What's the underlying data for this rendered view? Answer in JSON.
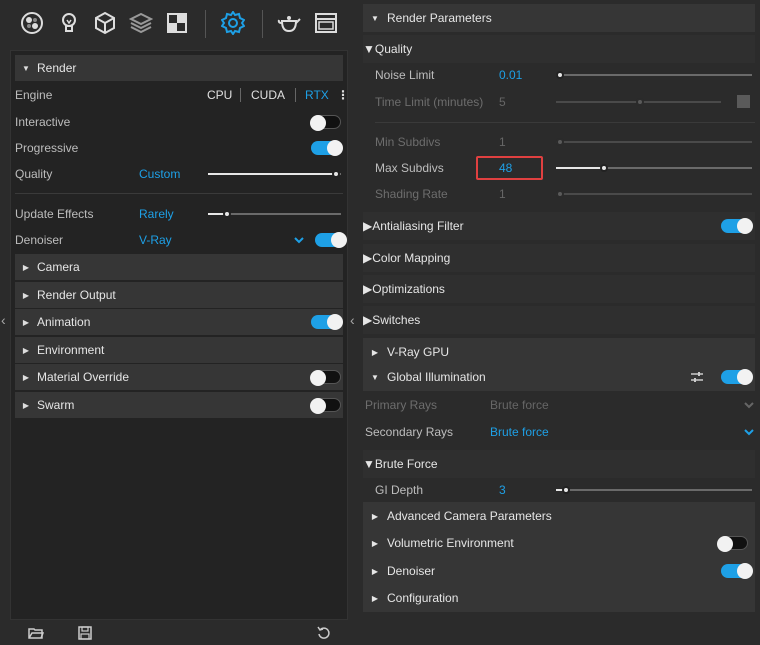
{
  "toolbar": {
    "icons": [
      "material-ball-icon",
      "light-bulb-icon",
      "cube-icon",
      "layers-icon",
      "texture-icon",
      "settings-gear-icon",
      "teapot-render-icon",
      "frame-buffer-icon"
    ]
  },
  "left": {
    "render_section": "Render",
    "engine": {
      "label": "Engine",
      "options": [
        "CPU",
        "CUDA",
        "RTX"
      ],
      "selected": "RTX"
    },
    "interactive": {
      "label": "Interactive",
      "on": false
    },
    "progressive": {
      "label": "Progressive",
      "on": true
    },
    "quality": {
      "label": "Quality",
      "value": "Custom"
    },
    "update_effects": {
      "label": "Update Effects",
      "value": "Rarely"
    },
    "denoiser": {
      "label": "Denoiser",
      "value": "V-Ray",
      "on": true
    },
    "sections": [
      {
        "label": "Camera"
      },
      {
        "label": "Render Output"
      },
      {
        "label": "Animation",
        "toggle": true
      },
      {
        "label": "Environment"
      },
      {
        "label": "Material Override",
        "toggle": false
      },
      {
        "label": "Swarm",
        "toggle": false
      }
    ]
  },
  "right": {
    "render_parameters": "Render Parameters",
    "quality": "Quality",
    "noise_limit": {
      "label": "Noise Limit",
      "value": "0.01"
    },
    "time_limit": {
      "label": "Time Limit (minutes)",
      "value": "5"
    },
    "min_subdivs": {
      "label": "Min Subdivs",
      "value": "1"
    },
    "max_subdivs": {
      "label": "Max Subdivs",
      "value": "48"
    },
    "shading_rate": {
      "label": "Shading Rate",
      "value": "1"
    },
    "antialiasing": "Antialiasing Filter",
    "color_mapping": "Color Mapping",
    "optimizations": "Optimizations",
    "switches": "Switches",
    "vray_gpu": "V-Ray GPU",
    "global_illumination": "Global Illumination",
    "primary_rays": {
      "label": "Primary Rays",
      "value": "Brute force"
    },
    "secondary_rays": {
      "label": "Secondary Rays",
      "value": "Brute force"
    },
    "brute_force": "Brute Force",
    "gi_depth": {
      "label": "GI Depth",
      "value": "3"
    },
    "advanced_camera": "Advanced Camera Parameters",
    "volumetric_env": "Volumetric Environment",
    "denoiser": "Denoiser",
    "configuration": "Configuration"
  },
  "colors": {
    "accent": "#1ea0e6",
    "highlight": "#e04040"
  }
}
